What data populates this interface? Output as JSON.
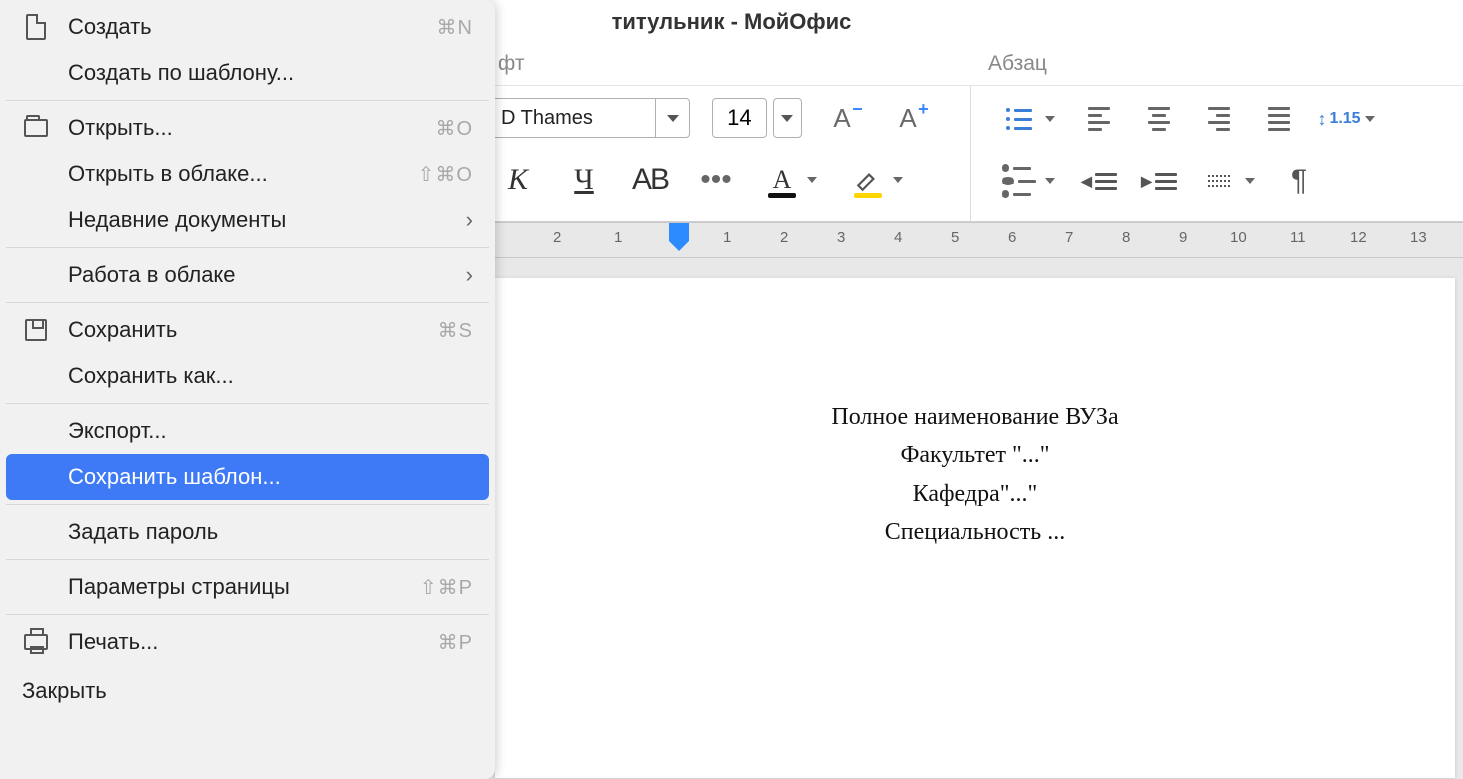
{
  "window": {
    "title": "титульник - МойОфис"
  },
  "toolbar": {
    "sections": {
      "font": "фт",
      "paragraph": "Абзац"
    },
    "font_name": "D Thames",
    "font_size": "14",
    "line_spacing": "1.15"
  },
  "ruler": {
    "numbers": [
      "2",
      "1",
      "",
      "1",
      "2",
      "3",
      "4",
      "5",
      "6",
      "7",
      "8",
      "9",
      "10",
      "11",
      "12",
      "13"
    ]
  },
  "document": {
    "lines": [
      "Полное наименование ВУЗа",
      "Факультет \"...\"",
      "Кафедра\"...\"",
      "Специальность ..."
    ]
  },
  "menu": {
    "new": "Создать",
    "new_sc": "⌘N",
    "new_tpl": "Создать по шаблону...",
    "open": "Открыть...",
    "open_sc": "⌘O",
    "open_cloud": "Открыть в облаке...",
    "open_cloud_sc": "⇧⌘O",
    "recent": "Недавние документы",
    "cloud_work": "Работа в облаке",
    "save": "Сохранить",
    "save_sc": "⌘S",
    "save_as": "Сохранить как...",
    "export": "Экспорт...",
    "save_tpl": "Сохранить шаблон...",
    "set_pw": "Задать пароль",
    "page_setup": "Параметры страницы",
    "page_setup_sc": "⇧⌘P",
    "print": "Печать...",
    "print_sc": "⌘P",
    "close": "Закрыть"
  }
}
